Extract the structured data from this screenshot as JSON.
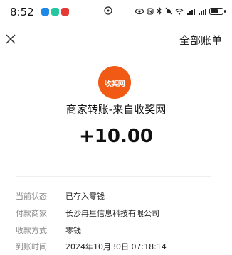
{
  "status_bar": {
    "time": "8:52",
    "right_indicators": [
      "eye-icon",
      "nfc-icon",
      "bluetooth-icon",
      "mute-icon",
      "wifi-icon",
      "signal-icon",
      "signal-icon",
      "battery-icon"
    ],
    "signal_label_1": "⁴⁶ᵢₗ",
    "signal_label_2": "⁴⁶ᵢₗ",
    "battery_level": 0.65
  },
  "header": {
    "all_bills_label": "全部账单"
  },
  "merchant": {
    "logo_text": "收奖网",
    "logo_color": "#f05a14",
    "title": "商家转账-来自收奖网"
  },
  "amount": "+10.00",
  "details": [
    {
      "label": "当前状态",
      "value": "已存入零钱"
    },
    {
      "label": "付款商家",
      "value": "长沙冉星信息科技有限公司"
    },
    {
      "label": "收款方式",
      "value": "零钱"
    },
    {
      "label": "到账时间",
      "value": "2024年10月30日 07:18:14"
    }
  ]
}
